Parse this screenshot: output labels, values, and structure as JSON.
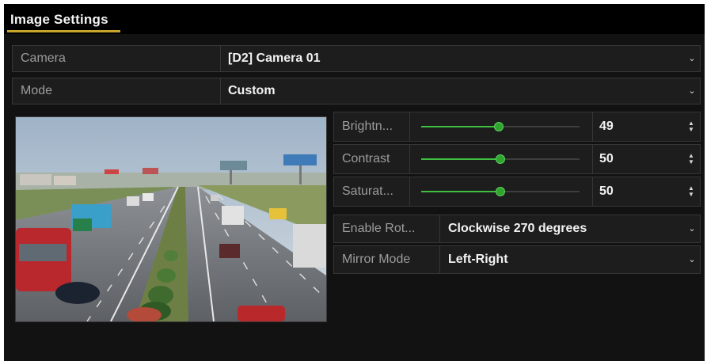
{
  "window": {
    "title": "Image Settings"
  },
  "fields": {
    "camera": {
      "label": "Camera",
      "value": "[D2] Camera 01"
    },
    "mode": {
      "label": "Mode",
      "value": "Custom"
    },
    "enable_rotate": {
      "label": "Enable Rot...",
      "value": "Clockwise 270 degrees"
    },
    "mirror_mode": {
      "label": "Mirror Mode",
      "value": "Left-Right"
    }
  },
  "sliders": [
    {
      "name": "brightness",
      "label": "Brightn...",
      "value": "49",
      "min": 0,
      "max": 100,
      "level": 49
    },
    {
      "name": "contrast",
      "label": "Contrast",
      "value": "50",
      "min": 0,
      "max": 100,
      "level": 50
    },
    {
      "name": "saturation",
      "label": "Saturat...",
      "value": "50",
      "min": 0,
      "max": 100,
      "level": 50
    }
  ],
  "icons": {
    "dropdown": "chevron-down-icon",
    "spinner": "spin-arrows-icon"
  },
  "colors": {
    "accent": "#c9a62b",
    "slider": "#3fbf3f",
    "background": "#121212",
    "row": "#1d1d1d"
  }
}
